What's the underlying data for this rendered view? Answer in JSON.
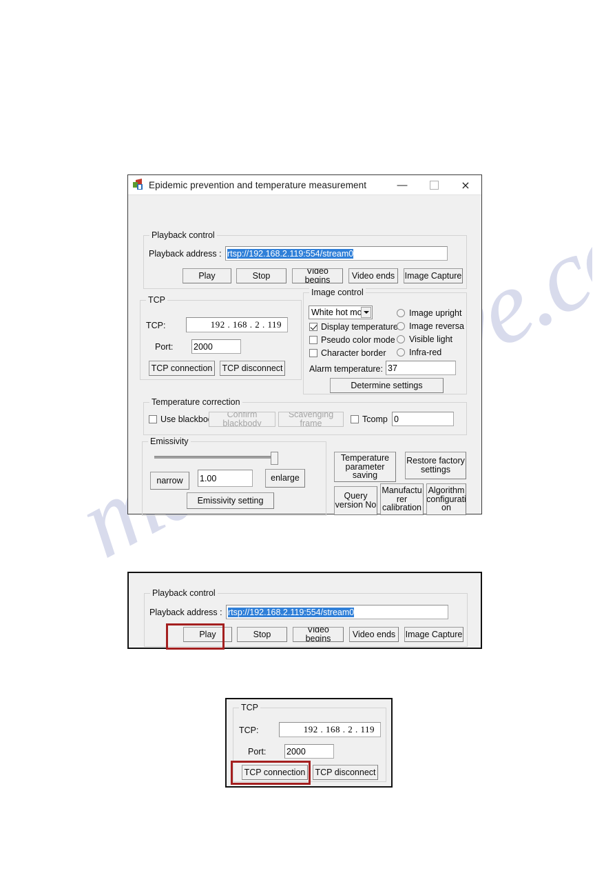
{
  "watermark": {
    "text": "manualshive.com"
  },
  "window": {
    "title": "Epidemic prevention and temperature measurement",
    "icon": "app-icon",
    "controls": {
      "minimize": "—",
      "maximize": "□",
      "close": "×"
    }
  },
  "playback_control": {
    "legend": "Playback control",
    "address_label": "Playback address :",
    "address_value": "rtsp://192.168.2.119:554/stream0",
    "buttons": [
      "Play",
      "Stop",
      "Video begins",
      "Video ends",
      "Image Capture"
    ]
  },
  "tcp": {
    "legend": "TCP",
    "ip_label": "TCP:",
    "ip_value": "192 . 168 .  2   . 119",
    "port_label": "Port:",
    "port_value": "2000",
    "connect_label": "TCP connection",
    "disconnect_label": "TCP disconnect"
  },
  "image_control": {
    "legend": "Image control",
    "mode_value": "White hot mod",
    "checkboxes": [
      {
        "label": "Display temperature",
        "checked": true
      },
      {
        "label": "Pseudo color mode",
        "checked": false
      },
      {
        "label": "Character border",
        "checked": false
      }
    ],
    "radios": [
      {
        "label": "Image upright",
        "selected": false
      },
      {
        "label": "Image reversa",
        "selected": false
      },
      {
        "label": "Visible light",
        "selected": false
      },
      {
        "label": "Infra-red",
        "selected": false
      }
    ],
    "alarm_label": "Alarm temperature:",
    "alarm_value": "37",
    "determine_label": "Determine settings"
  },
  "temperature_correction": {
    "legend": "Temperature correction",
    "use_blackbody_label": "Use blackbody",
    "use_blackbody_checked": false,
    "confirm_blackbody_label": "Confirm blackbody",
    "scavenging_frame_label": "Scavenging frame",
    "tcomp_label": "Tcomp",
    "tcomp_checked": false,
    "tcomp_value": "0"
  },
  "emissivity": {
    "legend": "Emissivity",
    "narrow_label": "narrow",
    "value": "1.00",
    "enlarge_label": "enlarge",
    "setting_label": "Emissivity setting"
  },
  "side_buttons": {
    "temperature_parameter_saving": "Temperature\nparameter\nsaving",
    "restore_factory_settings": "Restore factory\nsettings",
    "query_version_no": "Query\nversion No",
    "manufacturer_calibration": "Manufactu\nrer\ncalibration",
    "algorithm_configuration": "Algorithm\nconfigurati\non"
  },
  "clip_playback": {
    "legend": "Playback control",
    "address_label": "Playback address :",
    "address_value": "rtsp://192.168.2.119:554/stream0",
    "buttons": [
      "Play",
      "Stop",
      "Video begins",
      "Video ends",
      "Image Capture"
    ],
    "highlight": "Play"
  },
  "clip_tcp": {
    "legend": "TCP",
    "ip_label": "TCP:",
    "ip_value": "192 . 168 .  2   . 119",
    "port_label": "Port:",
    "port_value": "2000",
    "connect_label": "TCP connection",
    "disconnect_label": "TCP disconnect",
    "highlight": "TCP connection"
  },
  "colors": {
    "highlight_red": "#a41f1f",
    "selection_blue": "#2f7fd8",
    "window_face": "#f0f0f0"
  }
}
